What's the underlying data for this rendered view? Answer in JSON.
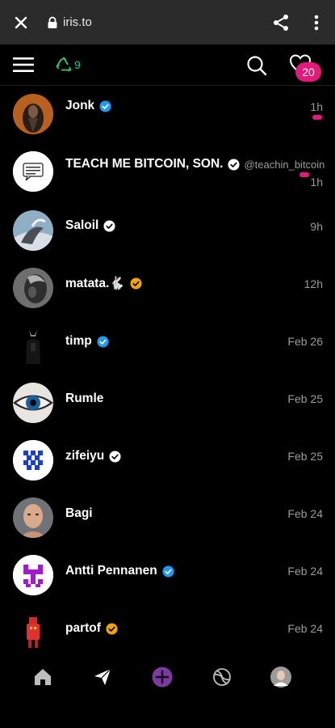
{
  "browser": {
    "url": "iris.to"
  },
  "header": {
    "relay_count": "9",
    "notification_count": "20"
  },
  "colors": {
    "accent": "#e5197a",
    "relay_green": "#2ecc71",
    "verified_blue": "#1d9bf0",
    "verified_orange": "#f0a500"
  },
  "messages": [
    {
      "name": "Jonk",
      "badge": "blue",
      "time": "1h",
      "unread": true
    },
    {
      "name": "TEACH ME BITCOIN, SON.",
      "badge": "white",
      "handle": "@teachin_bitcoin",
      "time": "1h",
      "unread": true
    },
    {
      "name": "Saloil",
      "badge": "white",
      "time": "9h"
    },
    {
      "name": "matata.🐇",
      "badge": "orange",
      "time": "12h"
    },
    {
      "name": "timp",
      "badge": "blue",
      "time": "Feb 26"
    },
    {
      "name": "Rumle",
      "time": "Feb 25"
    },
    {
      "name": "zifeiyu",
      "badge": "white",
      "time": "Feb 25"
    },
    {
      "name": "Bagi",
      "time": "Feb 24"
    },
    {
      "name": "Antti Pennanen",
      "badge": "blue",
      "time": "Feb 24"
    },
    {
      "name": "partof",
      "badge": "orange",
      "time": "Feb 24"
    }
  ],
  "bottom_nav": [
    "home-icon",
    "messages-icon",
    "new-post-icon",
    "explore-icon",
    "profile-avatar"
  ]
}
